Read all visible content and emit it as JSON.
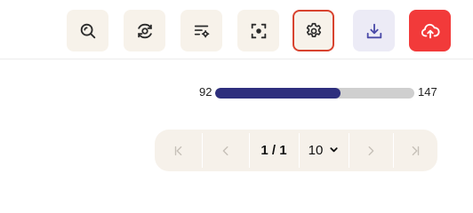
{
  "toolbar": {
    "buttons": [
      {
        "icon": "zoom-search-icon"
      },
      {
        "icon": "eye-refresh-icon"
      },
      {
        "icon": "filter-settings-icon"
      },
      {
        "icon": "focus-frame-icon"
      },
      {
        "icon": "gear-icon",
        "selected": true
      },
      {
        "icon": "download-icon"
      },
      {
        "icon": "cloud-upload-icon"
      }
    ],
    "colors": {
      "button_bg": "#f7f2ea",
      "download_bg": "#ecebf6",
      "upload_bg": "#f23a3a",
      "selected_border": "#d8432f"
    }
  },
  "progress": {
    "min_label": "92",
    "max_label": "147",
    "fill_fraction": 0.63,
    "fill_color": "#2e2f7d",
    "track_color": "#cfcfcf"
  },
  "pagination": {
    "page_label": "1 / 1",
    "page_size": "10",
    "first_icon": "first-page-icon",
    "prev_icon": "chevron-left-icon",
    "next_icon": "chevron-right-icon",
    "last_icon": "last-page-icon",
    "dropdown_icon": "chevron-down-icon"
  }
}
